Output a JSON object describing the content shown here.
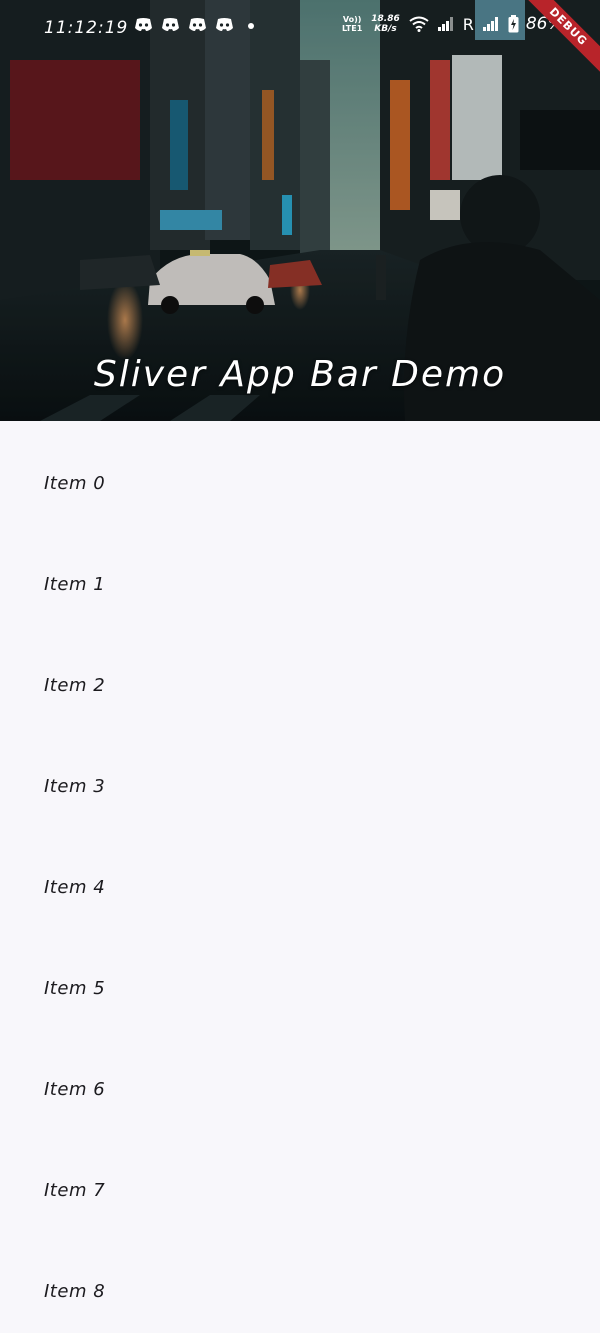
{
  "status_bar": {
    "time": "11:12:19",
    "volte": [
      "Vo))",
      "LTE1"
    ],
    "speed": [
      "18.86",
      "KB/s"
    ],
    "roaming": "R",
    "battery": "86%"
  },
  "debug_banner": "DEBUG",
  "app_bar": {
    "title": "Sliver App Bar Demo"
  },
  "list": {
    "items": [
      "Item 0",
      "Item 1",
      "Item 2",
      "Item 3",
      "Item 4",
      "Item 5",
      "Item 6",
      "Item 7",
      "Item 8"
    ]
  }
}
